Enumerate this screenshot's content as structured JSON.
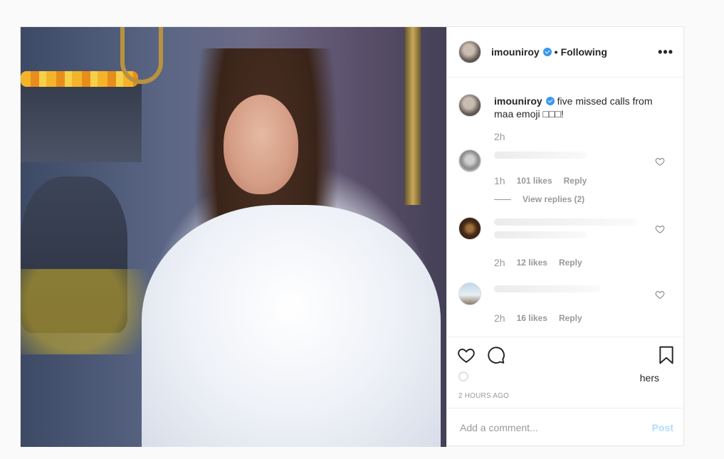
{
  "post": {
    "username": "imouniroy",
    "following_label": "Following",
    "dot": "•",
    "more_label": "•••"
  },
  "caption": {
    "username": "imouniroy",
    "text": "five missed calls from maa emoji □□□!",
    "time": "2h"
  },
  "comments": [
    {
      "time": "1h",
      "likes": "101 likes",
      "reply": "Reply",
      "view_replies": "View replies (2)"
    },
    {
      "time": "2h",
      "likes": "12 likes",
      "reply": "Reply"
    },
    {
      "time": "2h",
      "likes": "16 likes",
      "reply": "Reply"
    }
  ],
  "liked_by": {
    "tail": "hers"
  },
  "timeago": "2 HOURS AGO",
  "add_comment": {
    "placeholder": "Add a comment...",
    "post_label": "Post"
  },
  "colors": {
    "verified": "#3897f0",
    "post_button": "#b3dbff",
    "muted": "#999999"
  }
}
